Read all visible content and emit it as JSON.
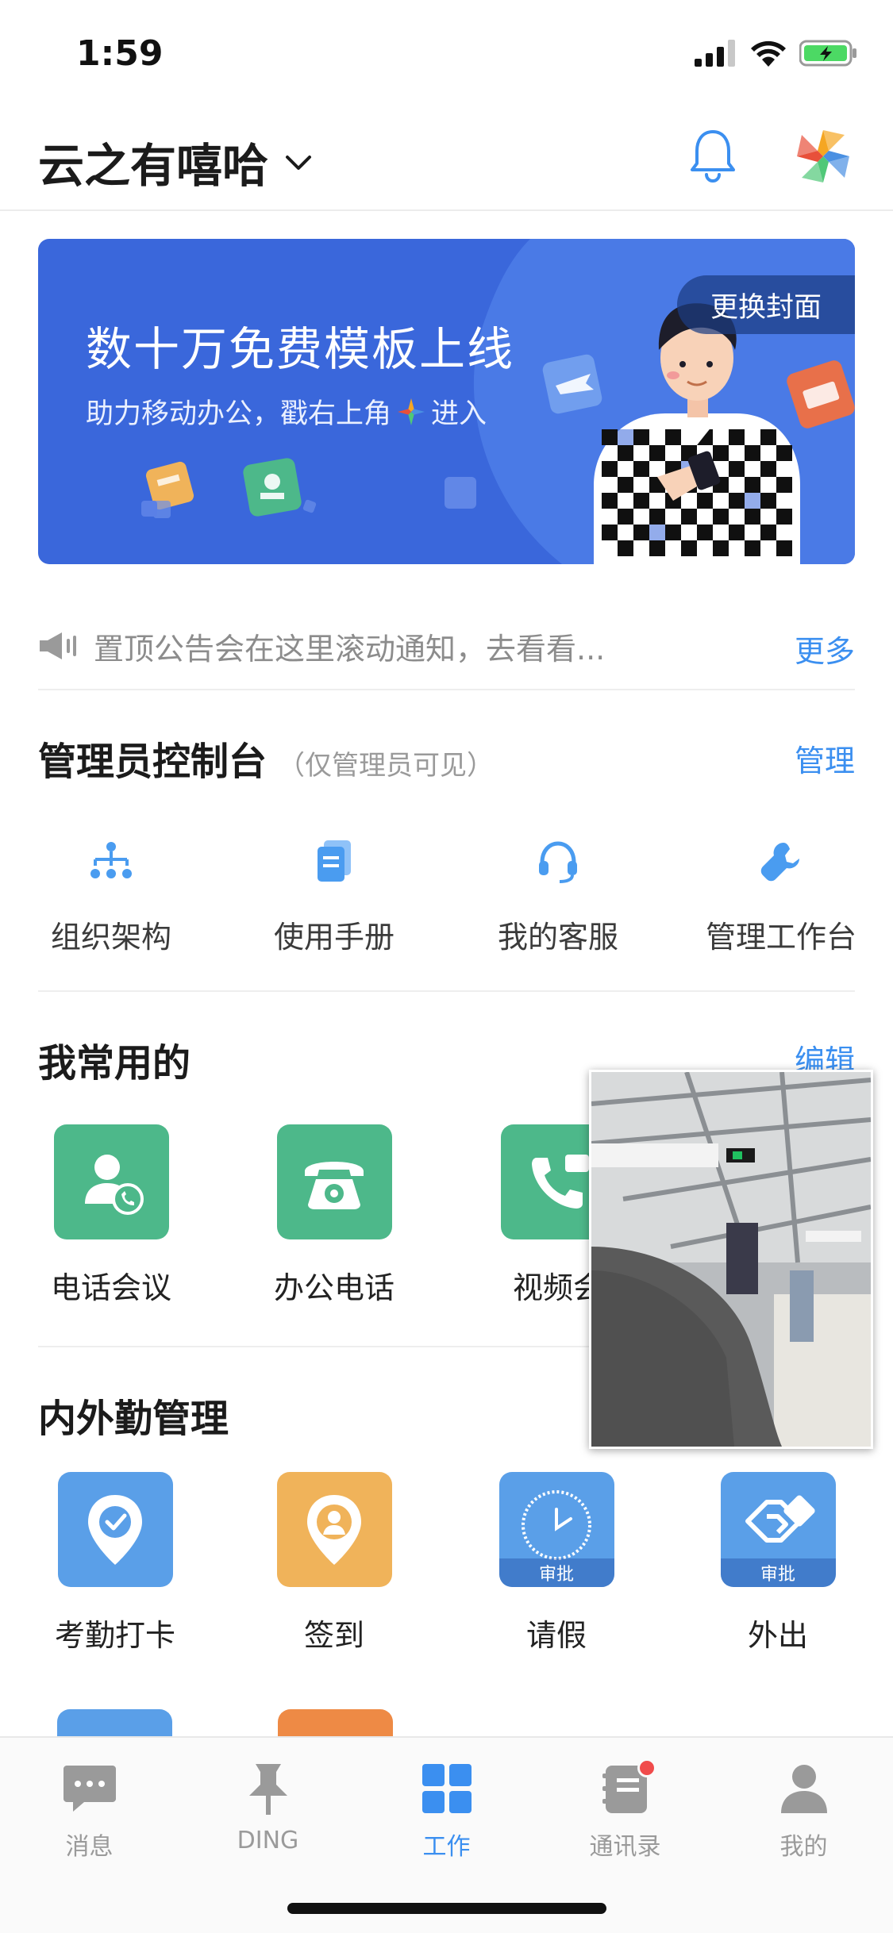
{
  "status_bar": {
    "time": "1:59"
  },
  "header": {
    "org_name": "云之有嘻哈"
  },
  "banner": {
    "headline": "数十万免费模板上线",
    "subtitle_prefix": "助力移动办公，戳右上角",
    "subtitle_suffix": "进入",
    "cover_button": "更换封面"
  },
  "notice": {
    "text": "置顶公告会在这里滚动通知，去看看...",
    "more": "更多"
  },
  "admin_console": {
    "title": "管理员控制台",
    "note": "（仅管理员可见）",
    "manage_link": "管理",
    "items": [
      {
        "label": "组织架构",
        "icon": "org-chart-icon"
      },
      {
        "label": "使用手册",
        "icon": "manual-icon"
      },
      {
        "label": "我的客服",
        "icon": "headset-icon"
      },
      {
        "label": "管理工作台",
        "icon": "wrench-icon"
      }
    ]
  },
  "frequent": {
    "title": "我常用的",
    "edit_link": "编辑",
    "items": [
      {
        "label": "电话会议",
        "icon": "conference-call-icon",
        "color": "#4db88a"
      },
      {
        "label": "办公电话",
        "icon": "office-phone-icon",
        "color": "#4db88a"
      },
      {
        "label": "视频会",
        "icon": "video-call-icon",
        "color": "#4db88a"
      }
    ]
  },
  "attendance": {
    "title": "内外勤管理",
    "items": [
      {
        "label": "考勤打卡",
        "icon": "location-check-icon",
        "color": "#5a9fe8"
      },
      {
        "label": "签到",
        "icon": "location-person-icon",
        "color": "#f0b35a"
      },
      {
        "label": "请假",
        "icon": "clock-icon",
        "color": "#5a9fe8",
        "tag": "审批"
      },
      {
        "label": "外出",
        "icon": "handshake-icon",
        "color": "#5a9fe8",
        "tag": "审批"
      }
    ]
  },
  "tabbar": {
    "tabs": [
      {
        "label": "消息",
        "icon": "message-icon"
      },
      {
        "label": "DING",
        "icon": "pin-icon"
      },
      {
        "label": "工作",
        "icon": "grid-icon",
        "active": true
      },
      {
        "label": "通讯录",
        "icon": "contacts-icon",
        "badge": true
      },
      {
        "label": "我的",
        "icon": "person-icon"
      }
    ]
  },
  "colors": {
    "accent": "#3b8ff0",
    "banner_bg": "#3a67db",
    "green_tile": "#4db88a",
    "blue_tile": "#5a9fe8",
    "orange_tile": "#f0b35a"
  }
}
